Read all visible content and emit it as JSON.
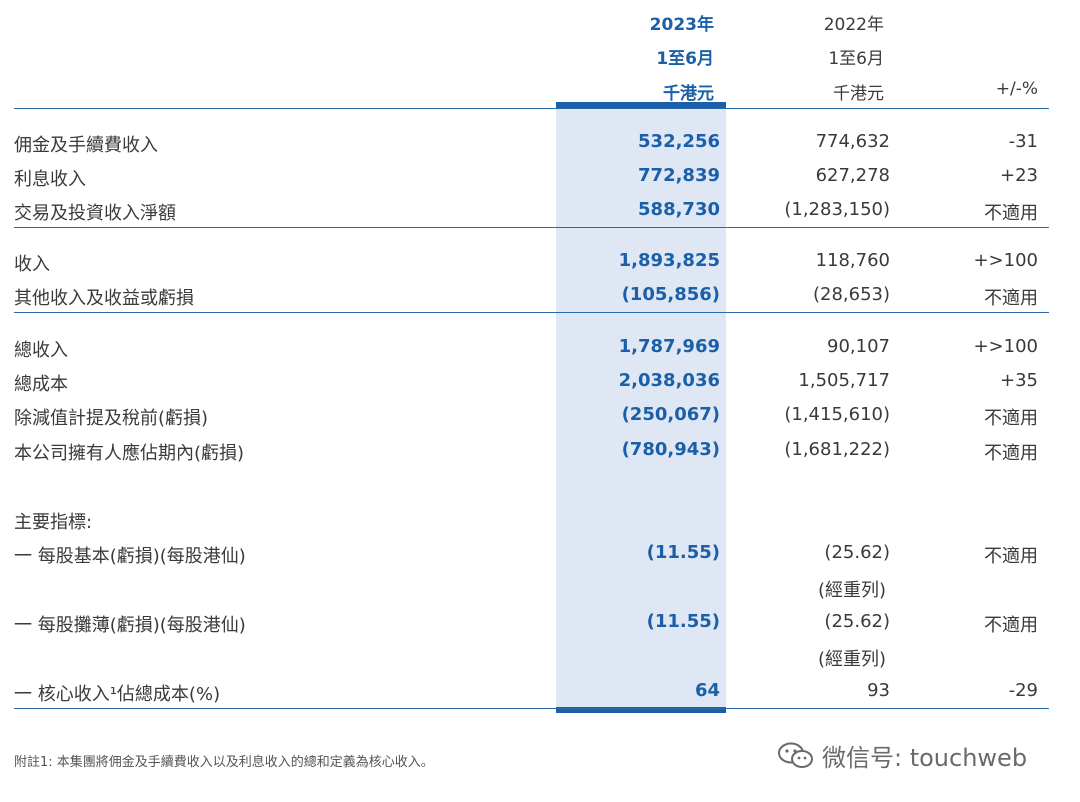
{
  "header": {
    "current": {
      "year": "2023年",
      "period": "1至6月",
      "unit": "千港元"
    },
    "prior": {
      "year": "2022年",
      "period": "1至6月",
      "unit": "千港元"
    },
    "change_label": "+/-%"
  },
  "rows": [
    {
      "label": "佣金及手續費收入",
      "current": "532,256",
      "prior": "774,632",
      "change": "-31"
    },
    {
      "label": "利息收入",
      "current": "772,839",
      "prior": "627,278",
      "change": "+23"
    },
    {
      "label": "交易及投資收入淨額",
      "current": "588,730",
      "prior": "(1,283,150)",
      "change": "不適用"
    },
    {
      "label": "收入",
      "current": "1,893,825",
      "prior": "118,760",
      "change": "+>100"
    },
    {
      "label": "其他收入及收益或虧損",
      "current": "(105,856)",
      "prior": "(28,653)",
      "change": "不適用"
    },
    {
      "label": "總收入",
      "current": "1,787,969",
      "prior": "90,107",
      "change": "+>100"
    },
    {
      "label": "總成本",
      "current": "2,038,036",
      "prior": "1,505,717",
      "change": "+35"
    },
    {
      "label": "除減值計提及稅前(虧損)",
      "current": "(250,067)",
      "prior": "(1,415,610)",
      "change": "不適用"
    },
    {
      "label": "本公司擁有人應佔期內(虧損)",
      "current": "(780,943)",
      "prior": "(1,681,222)",
      "change": "不適用"
    }
  ],
  "indicators": {
    "title": "主要指標:",
    "items": [
      {
        "label": "一 每股基本(虧損)(每股港仙)",
        "current": "(11.55)",
        "prior": "(25.62)",
        "prior_note": "(經重列)",
        "change": "不適用"
      },
      {
        "label": "一 每股攤薄(虧損)(每股港仙)",
        "current": "(11.55)",
        "prior": "(25.62)",
        "prior_note": "(經重列)",
        "change": "不適用"
      },
      {
        "label": "一 核心收入¹佔總成本(%)",
        "current": "64",
        "prior": "93",
        "change": "-29"
      }
    ]
  },
  "footnote": "附註1: 本集團將佣金及手續費收入以及利息收入的總和定義為核心收入。",
  "watermark": "微信号: touchweb",
  "colors": {
    "accent": "#1a5fa8",
    "highlight": "#dfe7f4",
    "rule": "#2b6aa8"
  }
}
